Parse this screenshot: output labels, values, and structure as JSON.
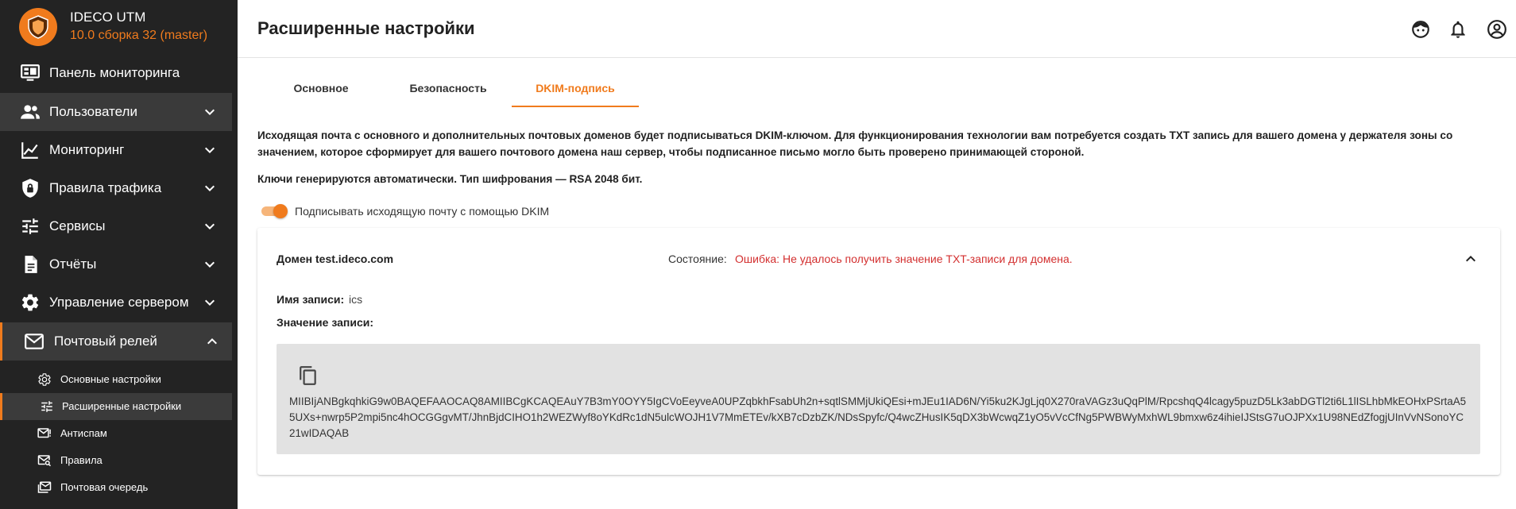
{
  "app": {
    "title": "IDECO UTM",
    "version": "10.0 сборка 32 (master)",
    "logo_icon": "shield-logo-icon"
  },
  "sidebar": {
    "items": [
      {
        "label": "Панель мониторинга",
        "icon": "monitor-dashboard-icon"
      },
      {
        "label": "Пользователи",
        "icon": "users-icon",
        "chevron": "down"
      },
      {
        "label": "Мониторинг",
        "icon": "chart-line-icon",
        "chevron": "down"
      },
      {
        "label": "Правила трафика",
        "icon": "shield-lock-icon",
        "chevron": "down"
      },
      {
        "label": "Сервисы",
        "icon": "tune-icon",
        "chevron": "down"
      },
      {
        "label": "Отчёты",
        "icon": "report-icon",
        "chevron": "down"
      },
      {
        "label": "Управление сервером",
        "icon": "gear-icon",
        "chevron": "down"
      },
      {
        "label": "Почтовый релей",
        "icon": "mail-icon",
        "chevron": "up",
        "expanded": true
      }
    ],
    "subitems": [
      {
        "label": "Основные настройки",
        "icon": "cog-icon"
      },
      {
        "label": "Расширенные настройки",
        "icon": "tune-icon",
        "active": true
      },
      {
        "label": "Антиспам",
        "icon": "mail-alert-icon"
      },
      {
        "label": "Правила",
        "icon": "mail-search-icon"
      },
      {
        "label": "Почтовая очередь",
        "icon": "mail-queue-icon"
      }
    ]
  },
  "header": {
    "title": "Расширенные настройки",
    "icons": [
      "support-icon",
      "bell-icon",
      "account-icon"
    ]
  },
  "tabs": [
    {
      "label": "Основное"
    },
    {
      "label": "Безопасность"
    },
    {
      "label": "DKIM-подпись",
      "active": true
    }
  ],
  "content": {
    "description": "Исходящая почта с основного и дополнительных почтовых доменов будет подписываться DKIM-ключом. Для функционирования технологии вам потребуется создать TXT запись для вашего домена у держателя зоны со значением, которое сформирует для вашего почтового домена наш сервер, чтобы подписанное письмо могло быть проверено принимающей стороной.",
    "keys_note": "Ключи генерируются автоматически. Тип шифрования — RSA 2048 бит.",
    "toggle": {
      "label": "Подписывать исходящую почту с помощью DKIM",
      "checked": true
    },
    "domain_card": {
      "domain": "Домен test.ideco.com",
      "status_label": "Состояние:",
      "status_text": "Ошибка: Не удалось получить значение TXT-записи для домена.",
      "record_name_label": "Имя записи:",
      "record_name": "ics",
      "record_value_label": "Значение записи:",
      "record_value": "MIIBIjANBgkqhkiG9w0BAQEFAAOCAQ8AMIIBCgKCAQEAuY7B3mY0OYY5IgCVoEeyveA0UPZqbkhFsabUh2n+sqtlSMMjUkiQEsi+mJEu1IAD6N/Yi5ku2KJgLjq0X270raVAGz3uQqPlM/RpcshqQ4lcagy5puzD5Lk3abDGTl2ti6L1lISLhbMkEOHxPSrtaA55UXs+nwrp5P2mpi5nc4hOCGGgvMT/JhnBjdCIHO1h2WEZWyf8oYKdRc1dN5ulcWOJH1V7MmETEv/kXB7cDzbZK/NDsSpyfc/Q4wcZHusIK5qDX3bWcwqZ1yO5vVcCfNg5PWBWyMxhWL9bmxw6z4ihieIJStsG7uOJPXx1U98NEdZfogjUInVvNSonoYC21wIDAQAB",
      "copy_icon": "copy-icon",
      "collapse_icon": "chevron-up-icon"
    }
  },
  "colors": {
    "accent": "#f07b1d",
    "error": "#d32f2f",
    "sidebar_bg": "#232323",
    "sidebar_highlight": "#3a3a3a",
    "record_box_bg": "#e2e2e2"
  }
}
